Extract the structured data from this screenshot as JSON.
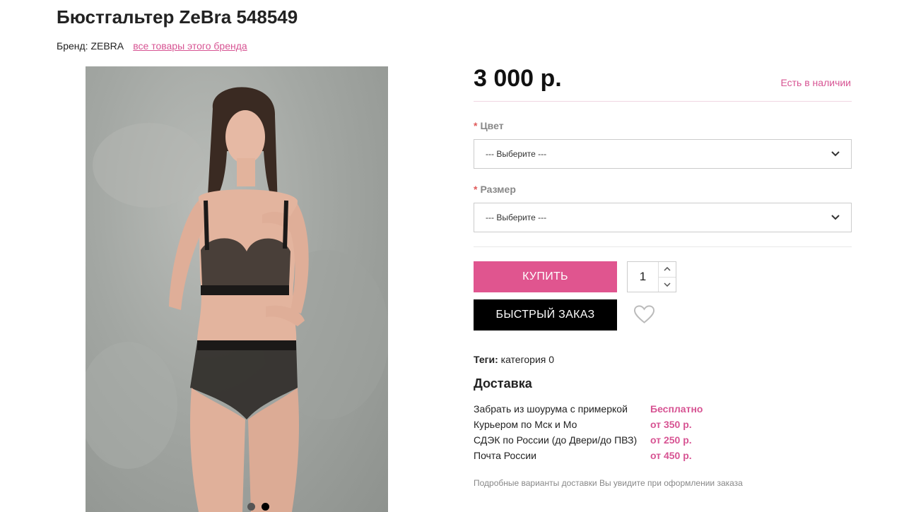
{
  "product": {
    "title": "Бюстгальтер ZeBra 548549",
    "brand_label": "Бренд: ZEBRA",
    "brand_link": "все товары этого бренда",
    "price": "3 000 р.",
    "stock": "Есть в наличии"
  },
  "gallery": {
    "slides": 2,
    "active_slide": 2
  },
  "options": {
    "color": {
      "label": "Цвет",
      "required_mark": "*",
      "selected": "--- Выберите ---"
    },
    "size": {
      "label": "Размер",
      "required_mark": "*",
      "selected": "--- Выберите ---"
    }
  },
  "actions": {
    "buy": "КУПИТЬ",
    "quantity": "1",
    "fast_order": "БЫСТРЫЙ ЗАКАЗ",
    "wishlist_icon": "heart-icon"
  },
  "tags": {
    "label": "Теги:",
    "value": "категория 0"
  },
  "delivery": {
    "title": "Доставка",
    "methods": [
      {
        "name": "Забрать из шоурума с примеркой",
        "cost": "Бесплатно"
      },
      {
        "name": "Курьером по Мск и Мо",
        "cost": "от 350 р."
      },
      {
        "name": "СДЭК по России (до Двери/до ПВЗ)",
        "cost": "от 250 р."
      },
      {
        "name": "Почта России",
        "cost": "от 450 р."
      }
    ],
    "note": "Подробные варианты доставки Вы увидите при оформлении заказа"
  },
  "colors": {
    "accent": "#e0558f",
    "link": "#d75493",
    "dark": "#000000"
  }
}
